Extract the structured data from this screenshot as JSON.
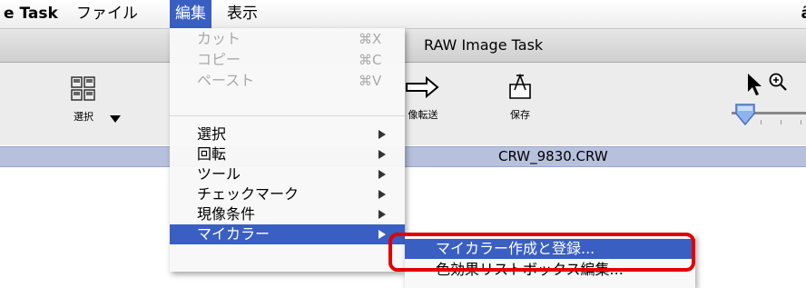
{
  "menubar": {
    "app": "e Task",
    "file": "ファイル",
    "edit": "編集",
    "view": "表示",
    "right_glyph": "ã"
  },
  "window": {
    "title": "RAW Image Task"
  },
  "toolbar": {
    "select_label": "選択",
    "transfer_label": "像転送",
    "save_label": "保存"
  },
  "filebar": {
    "filename": "CRW_9830.CRW"
  },
  "edit_menu": {
    "items": [
      {
        "label": "カット",
        "shortcut": "⌘X",
        "enabled": false
      },
      {
        "label": "コピー",
        "shortcut": "⌘C",
        "enabled": false
      },
      {
        "label": "ペースト",
        "shortcut": "⌘V",
        "enabled": false
      },
      {
        "label": "選択",
        "submenu": true
      },
      {
        "label": "回転",
        "submenu": true
      },
      {
        "label": "ツール",
        "submenu": true
      },
      {
        "label": "チェックマーク",
        "submenu": true
      },
      {
        "label": "現像条件",
        "submenu": true
      },
      {
        "label": "マイカラー",
        "submenu": true,
        "highlighted": true
      }
    ]
  },
  "mycolor_submenu": {
    "items": [
      {
        "label": "マイカラー作成と登録...",
        "highlighted": true
      },
      {
        "label": "色効果リストボックス編集..."
      }
    ]
  },
  "colors": {
    "accent": "#3a5fc2",
    "callout": "#e00000",
    "filebar": "#b7c1de"
  }
}
